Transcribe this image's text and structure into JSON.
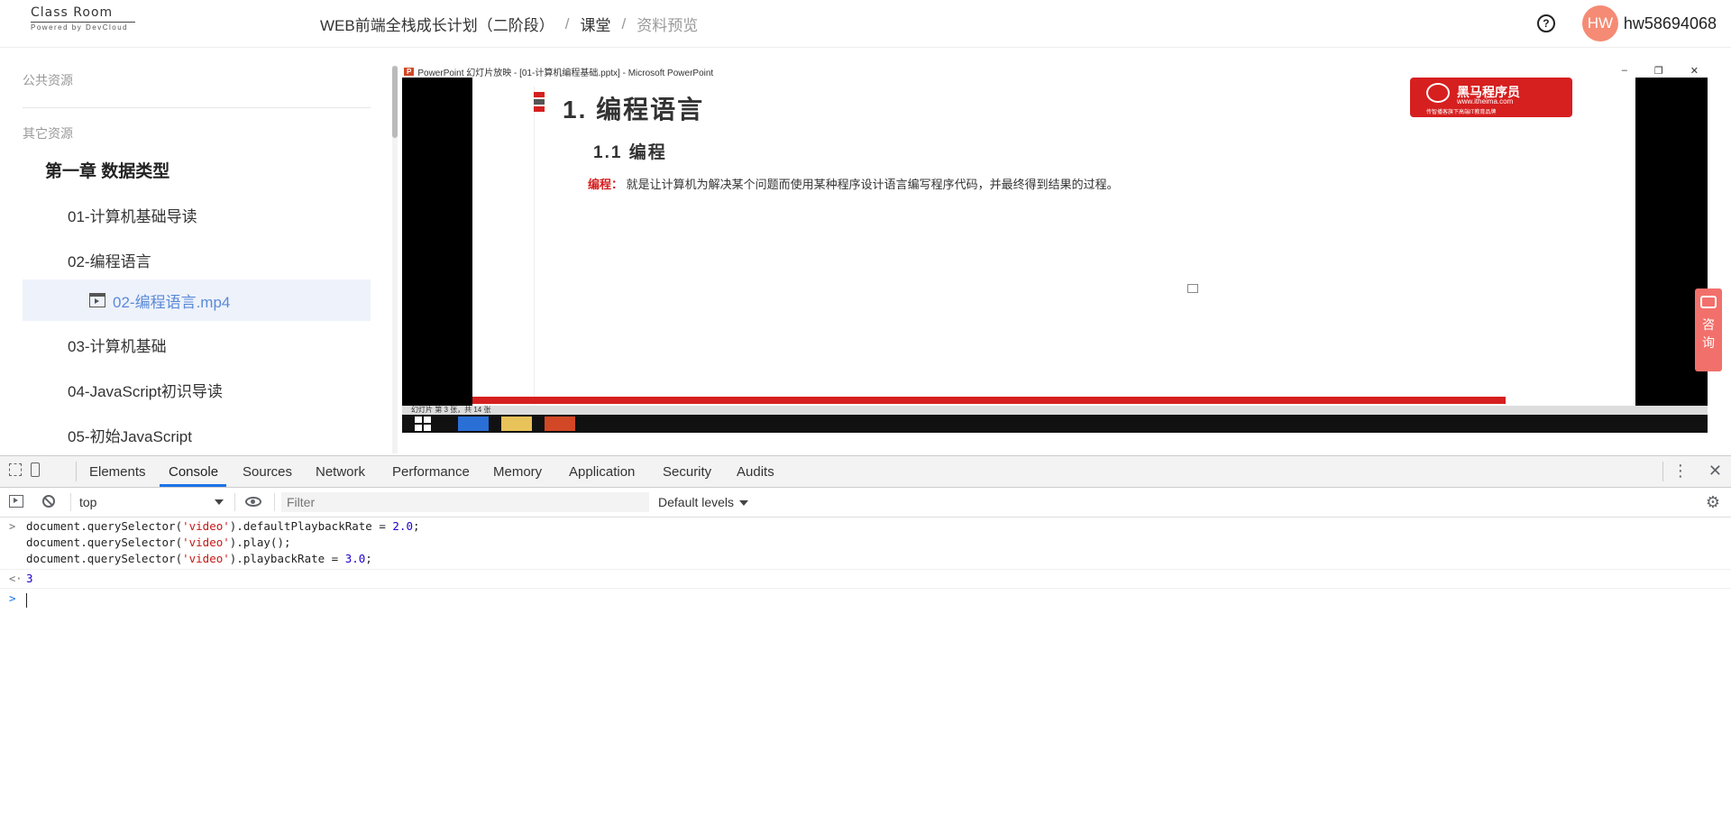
{
  "header": {
    "logo_text": "Class Room",
    "logo_sub": "Powered by DevCloud",
    "breadcrumb": [
      "WEB前端全栈成长计划（二阶段）",
      "课堂",
      "资料预览"
    ],
    "avatar_initials": "HW",
    "username": "hw58694068"
  },
  "sidebar": {
    "public_resources": "公共资源",
    "other_resources": "其它资源",
    "chapter": "第一章 数据类型",
    "lessons": [
      "01-计算机基础导读",
      "02-编程语言",
      "03-计算机基础",
      "04-JavaScript初识导读",
      "05-初始JavaScript"
    ],
    "active_file": "02-编程语言.mp4"
  },
  "video": {
    "ppt_title": "PowerPoint 幻灯片放映 - [01-计算机编程基础.pptx] - Microsoft PowerPoint",
    "slide_h1": "1. 编程语言",
    "slide_h2": "1.1 编程",
    "slide_keyword": "编程：",
    "slide_text": "就是让计算机为解决某个问题而使用某种程序设计语言编写程序代码，并最终得到结果的过程。",
    "brand": "黑马程序员",
    "brand_url": "www.itheima.com",
    "brand_tagline": "传智播客旗下高端IT教育品牌",
    "status": "幻灯片 第 3 张，共 14 张"
  },
  "consult": {
    "label": "咨询",
    "color": "#f2706b"
  },
  "devtools": {
    "tabs": [
      "Elements",
      "Console",
      "Sources",
      "Network",
      "Performance",
      "Memory",
      "Application",
      "Security",
      "Audits"
    ],
    "active_tab": "Console",
    "context": "top",
    "filter_placeholder": "Filter",
    "levels": "Default levels",
    "console_lines": [
      {
        "obj": "document.querySelector(",
        "str": "'video'",
        "mid": ").defaultPlaybackRate = ",
        "num": "2.0",
        "end": ";"
      },
      {
        "obj": "document.querySelector(",
        "str": "'video'",
        "mid": ").play();",
        "num": "",
        "end": ""
      },
      {
        "obj": "document.querySelector(",
        "str": "'video'",
        "mid": ").playbackRate = ",
        "num": "3.0",
        "end": ";"
      }
    ],
    "result": "3",
    "accent": "#1a73e8"
  }
}
